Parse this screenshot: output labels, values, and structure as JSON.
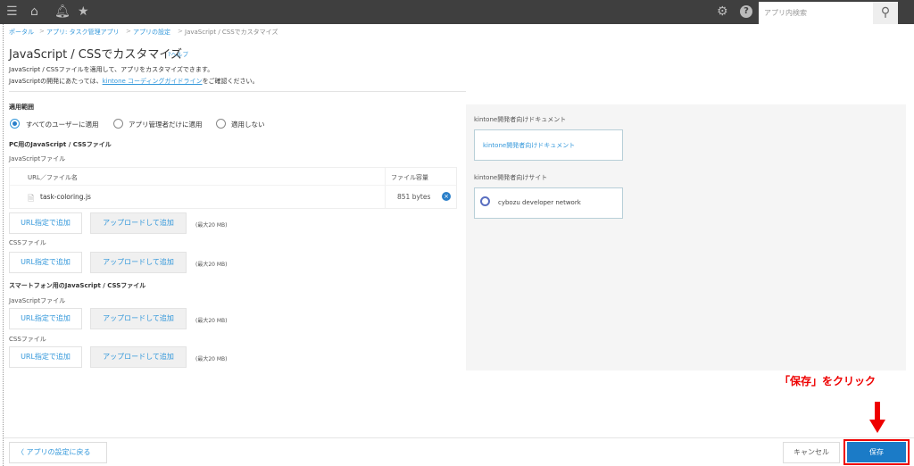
{
  "topbar": {
    "search_placeholder": "アプリ内検索",
    "icons": [
      "menu-icon",
      "home-icon",
      "bell-icon",
      "star-icon",
      "gear-icon",
      "help-icon",
      "search-icon"
    ]
  },
  "breadcrumb": [
    "ポータル",
    "アプリ: タスク管理アプリ",
    "アプリの設定",
    "JavaScript / CSSでカスタマイズ"
  ],
  "breadcrumb_sep": ">",
  "page": {
    "title": "JavaScript / CSSでカスタマイズ",
    "help": "?ヘルプ",
    "desc1": "JavaScript / CSSファイルを適用して、アプリをカスタマイズできます。",
    "desc2_pre": "JavaScriptの開発にあたっては、",
    "desc2_link": "kintone コーディングガイドライン",
    "desc2_post": "をご確認ください。"
  },
  "scope": {
    "label": "適用範囲",
    "options": [
      "すべてのユーザーに適用",
      "アプリ管理者だけに適用",
      "適用しない"
    ],
    "selected": 0
  },
  "pc": {
    "header": "PC用のJavaScript / CSSファイル",
    "js_label": "JavaScriptファイル",
    "css_label": "CSSファイル",
    "table": {
      "col_name": "URL／ファイル名",
      "col_size": "ファイル容量",
      "rows": [
        {
          "name": "task-coloring.js",
          "size": "851 bytes"
        }
      ]
    }
  },
  "sp": {
    "header": "スマートフォン用のJavaScript / CSSファイル",
    "js_label": "JavaScriptファイル",
    "css_label": "CSSファイル"
  },
  "buttons": {
    "url_add": "URL指定で追加",
    "upload_add": "アップロードして追加",
    "max_note": "(最大20 MB)"
  },
  "right": {
    "doc_label": "kintone開発者向けドキュメント",
    "doc_link": "kintone開発者向けドキュメント",
    "site_label": "kintone開発者向けサイト",
    "site_link": "cybozu developer network"
  },
  "footer": {
    "back": "アプリの設定に戻る",
    "cancel": "キャンセル",
    "save": "保存"
  },
  "annotation": {
    "text": "「保存」をクリック",
    "color": "#ee0000"
  },
  "colors": {
    "accent": "#1b7bc7",
    "link": "#3498db",
    "topbar": "#3f3f3f"
  }
}
